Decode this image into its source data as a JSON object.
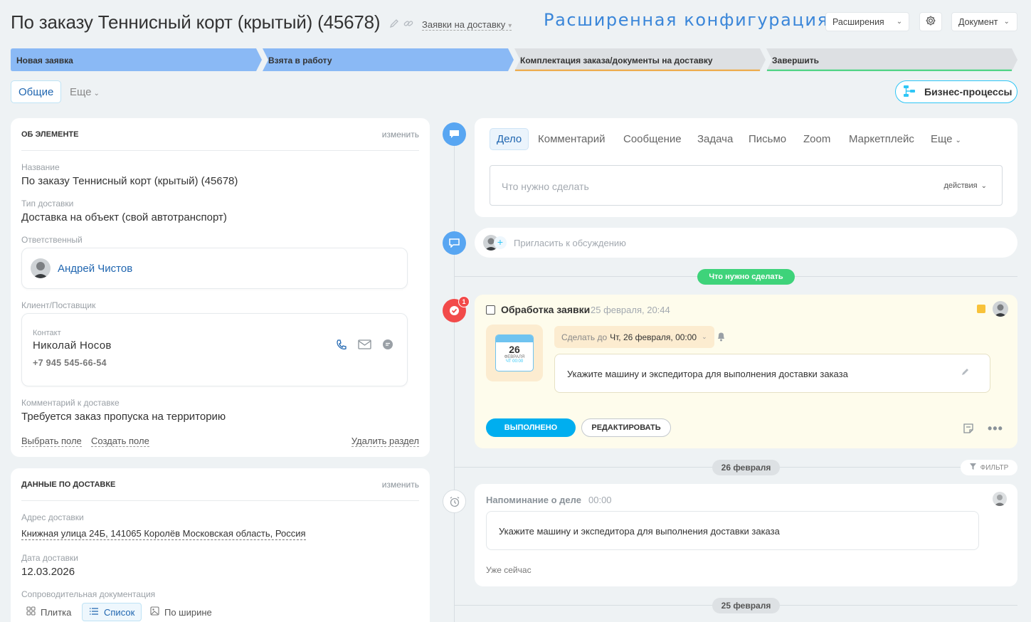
{
  "header": {
    "title": "По заказу Теннисный корт (крытый) (45678)",
    "category": "Заявки на доставку",
    "ext_config": "Расширенная конфигурация",
    "extensions_btn": "Расширения",
    "document_btn": "Документ"
  },
  "stages": [
    {
      "label": "Новая заявка",
      "color": "#8ab9f5",
      "accent": "#8ab9f5"
    },
    {
      "label": "Взята в работу",
      "color": "#8ab9f5",
      "accent": "#8ab9f5"
    },
    {
      "label": "Комплектация заказа/документы на доставку",
      "color": "#dde0e3",
      "accent": "#f0a53a"
    },
    {
      "label": "Завершить",
      "color": "#dde0e3",
      "accent": "#3ed37a"
    }
  ],
  "tabs": {
    "general": "Общие",
    "more": "Еще",
    "business_processes": "Бизнес-процессы"
  },
  "about": {
    "header": "ОБ ЭЛЕМЕНТЕ",
    "edit": "изменить",
    "name_label": "Название",
    "name_value": "По заказу Теннисный корт (крытый) (45678)",
    "delivery_type_label": "Тип доставки",
    "delivery_type_value": "Доставка на объект (свой автотранспорт)",
    "responsible_label": "Ответственный",
    "responsible_value": "Андрей Чистов",
    "client_label": "Клиент/Поставщик",
    "contact_label": "Контакт",
    "contact_name": "Николай Носов",
    "contact_phone": "+7 945 545-66-54",
    "comment_label": "Комментарий к доставке",
    "comment_value": "Требуется заказ пропуска на территорию",
    "choose_field": "Выбрать поле",
    "create_field": "Создать поле",
    "delete_section": "Удалить раздел"
  },
  "delivery": {
    "header": "ДАННЫЕ ПО ДОСТАВКЕ",
    "edit": "изменить",
    "address_label": "Адрес доставки",
    "address_value": "Книжная улица 24Б, 141065 Королёв Московская область, Россия",
    "date_label": "Дата доставки",
    "date_value": "12.03.2026",
    "docs_label": "Сопроводительная документация",
    "view_tile": "Плитка",
    "view_list": "Список",
    "view_wide": "По ширине"
  },
  "composer": {
    "tabs": [
      "Дело",
      "Комментарий",
      "Сообщение",
      "Задача",
      "Письмо",
      "Zoom",
      "Маркетплейс",
      "Еще"
    ],
    "placeholder": "Что нужно сделать",
    "actions": "действия"
  },
  "invite": {
    "placeholder": "Пригласить к обсуждению"
  },
  "todo_pill": "Что нужно сделать",
  "task": {
    "badge": "1",
    "title": "Обработка заявки",
    "datetime": "25 февраля, 20:44",
    "cal_day": "26",
    "cal_month": "ФЕВРАЛЯ",
    "cal_time": "ЧТ 00:00",
    "deadline_prefix": "Сделать до",
    "deadline_value": "Чт, 26 февраля, 00:00",
    "description": "Укажите машину и экспедитора для выполнения доставки заказа",
    "done_btn": "ВЫПОЛНЕНО",
    "edit_btn": "РЕДАКТИРОВАТЬ"
  },
  "date_sep_1": "26 февраля",
  "filter": "ФИЛЬТР",
  "reminder": {
    "title": "Напоминание о деле",
    "time": "00:00",
    "text": "Укажите машину и экспедитора для выполнения доставки заказа",
    "footer": "Уже сейчас"
  },
  "date_sep_2": "25 февраля",
  "colors": {
    "accent_blue": "#2fc6f6",
    "done_blue": "#00aeef",
    "green_pill": "#3ed37a",
    "task_bg": "#fefcec",
    "red_icon": "#f24a4a"
  }
}
